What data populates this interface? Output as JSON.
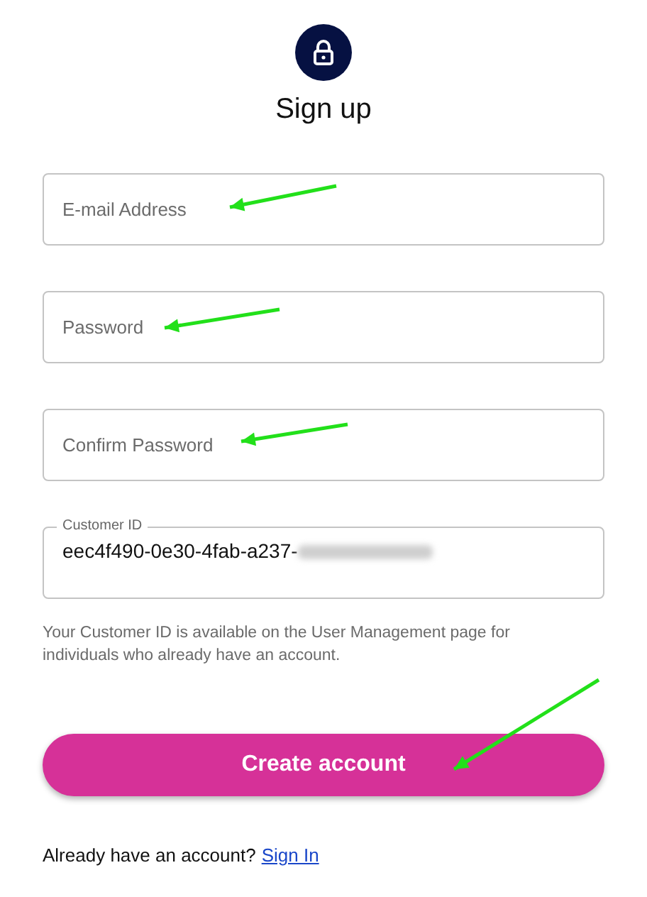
{
  "title": "Sign up",
  "fields": [
    {
      "placeholder": "E-mail Address"
    },
    {
      "placeholder": "Password"
    },
    {
      "placeholder": "Confirm Password"
    }
  ],
  "customer_id": {
    "label": "Customer ID",
    "value": "eec4f490-0e30-4fab-a237-"
  },
  "helper_text": "Your Customer ID is available on the User Management page for individuals who already have an account.",
  "primary_button": "Create account",
  "footer": {
    "text": "Already have an account?",
    "link": "Sign In"
  }
}
